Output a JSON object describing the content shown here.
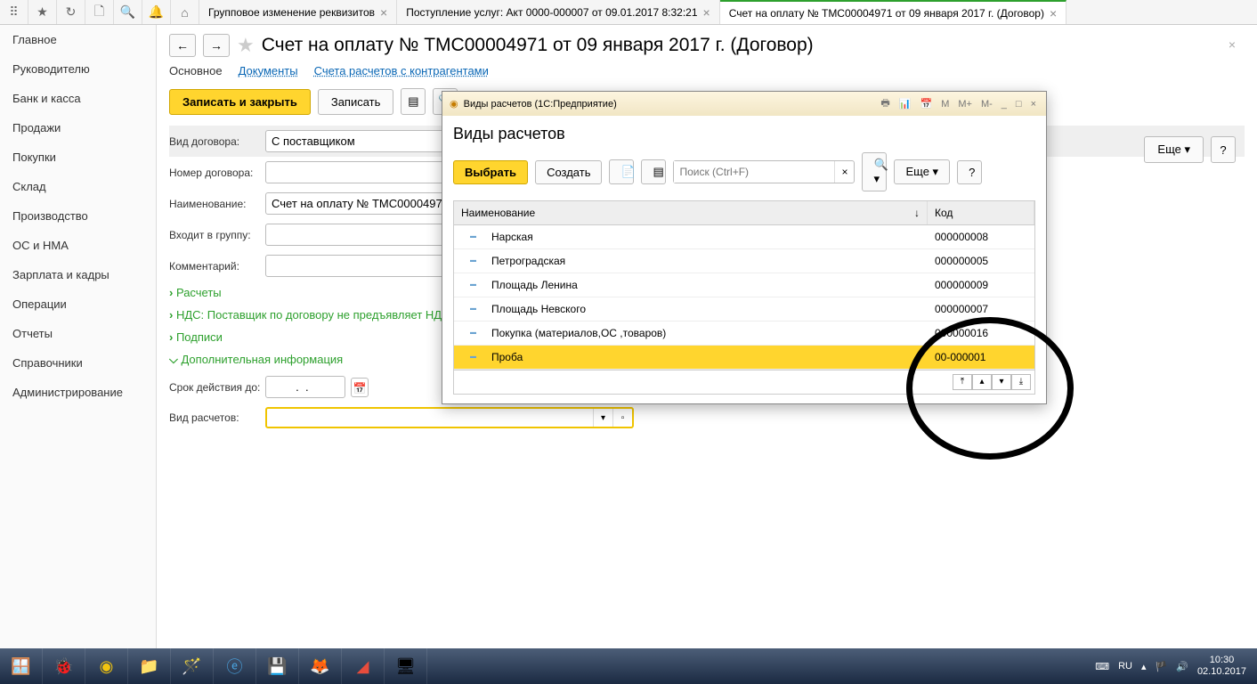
{
  "tabs": [
    {
      "label": "Групповое изменение реквизитов"
    },
    {
      "label": "Поступление услуг: Акт 0000-000007 от 09.01.2017 8:32:21"
    },
    {
      "label": "Счет на оплату № ТМС00004971 от 09 января 2017 г. (Договор)"
    }
  ],
  "sidebar": {
    "items": [
      "Главное",
      "Руководителю",
      "Банк и касса",
      "Продажи",
      "Покупки",
      "Склад",
      "Производство",
      "ОС и НМА",
      "Зарплата и кадры",
      "Операции",
      "Отчеты",
      "Справочники",
      "Администрирование"
    ]
  },
  "page": {
    "title": "Счет на оплату № ТМС00004971 от 09 января 2017 г. (Договор)",
    "subnav": {
      "main": "Основное",
      "docs": "Документы",
      "counter": "Счета расчетов с контрагентами"
    },
    "toolbar": {
      "save_close": "Записать и закрыть",
      "save": "Записать",
      "more": "Еще",
      "help": "?"
    },
    "form": {
      "vid_dogovora_label": "Вид договора:",
      "vid_dogovora": "С поставщиком",
      "nomer_label": "Номер договора:",
      "naim_label": "Наименование:",
      "naim": "Счет на оплату № ТМС00004971 от",
      "group_label": "Входит в группу:",
      "comment_label": "Комментарий:",
      "expand": {
        "raschety": "Расчеты",
        "nds": "НДС: Поставщик по договору не предъявляет НД",
        "podpisi": "Подписи",
        "dop": "Дополнительная информация"
      },
      "srok_label": "Срок действия до:",
      "srok": "  .  .    ",
      "vid_rasch_label": "Вид расчетов:"
    }
  },
  "modal": {
    "title_prefix": "Виды расчетов  (1С:Предприятие)",
    "mbuttons": [
      "M",
      "M+",
      "M-"
    ],
    "heading": "Виды расчетов",
    "toolbar": {
      "select": "Выбрать",
      "create": "Создать",
      "search_ph": "Поиск (Ctrl+F)",
      "more": "Еще",
      "help": "?"
    },
    "columns": {
      "name": "Наименование",
      "code": "Код"
    },
    "rows": [
      {
        "name": "Нарская",
        "code": "000000008"
      },
      {
        "name": "Петроградская",
        "code": "000000005"
      },
      {
        "name": "Площадь Ленина",
        "code": "000000009"
      },
      {
        "name": "Площадь Невского",
        "code": "000000007"
      },
      {
        "name": "Покупка (материалов,ОС ,товаров)",
        "code": "000000016"
      },
      {
        "name": "Проба",
        "code": "00-000001"
      }
    ]
  },
  "tray": {
    "lang": "RU",
    "time": "10:30",
    "date": "02.10.2017"
  }
}
